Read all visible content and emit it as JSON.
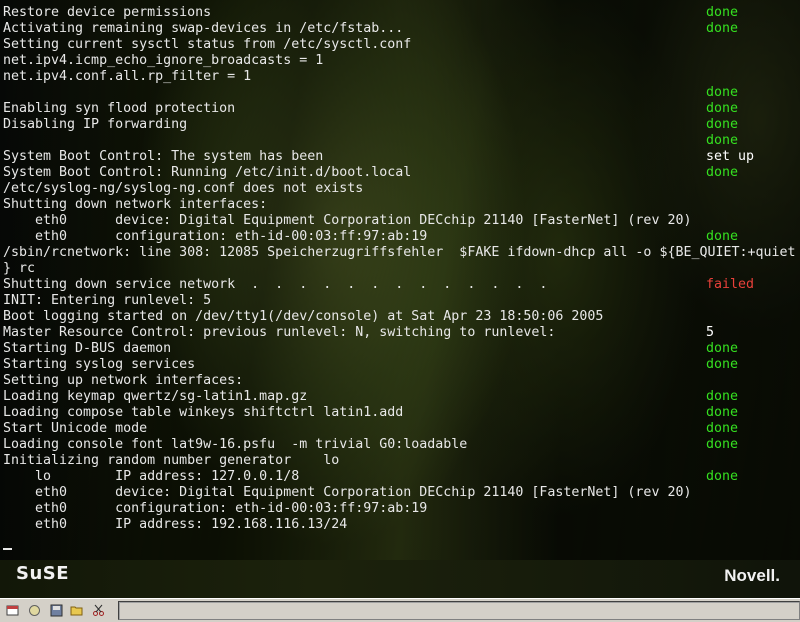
{
  "console": {
    "lines": [
      "Restore device permissions",
      "Activating remaining swap-devices in /etc/fstab...",
      "Setting current sysctl status from /etc/sysctl.conf",
      "net.ipv4.icmp_echo_ignore_broadcasts = 1",
      "net.ipv4.conf.all.rp_filter = 1",
      "",
      "Enabling syn flood protection",
      "Disabling IP forwarding",
      "",
      "System Boot Control: The system has been",
      "System Boot Control: Running /etc/init.d/boot.local",
      "/etc/syslog-ng/syslog-ng.conf does not exists",
      "Shutting down network interfaces:",
      "    eth0      device: Digital Equipment Corporation DECchip 21140 [FasterNet] (rev 20)",
      "    eth0      configuration: eth-id-00:03:ff:97:ab:19",
      "/sbin/rcnetwork: line 308: 12085 Speicherzugriffsfehler  $FAKE ifdown-dhcp all -o ${BE_QUIET:+quiet",
      "} rc",
      "Shutting down service network  .  .  .  .  .  .  .  .  .  .  .  .  .",
      "INIT: Entering runlevel: 5",
      "Boot logging started on /dev/tty1(/dev/console) at Sat Apr 23 18:50:06 2005",
      "Master Resource Control: previous runlevel: N, switching to runlevel:",
      "Starting D-BUS daemon",
      "Starting syslog services",
      "Setting up network interfaces:",
      "Loading keymap qwertz/sg-latin1.map.gz",
      "Loading compose table winkeys shiftctrl latin1.add",
      "Start Unicode mode",
      "Loading console font lat9w-16.psfu  -m trivial G0:loadable",
      "Initializing random number generator    lo",
      "    lo        IP address: 127.0.0.1/8",
      "    eth0      device: Digital Equipment Corporation DECchip 21140 [FasterNet] (rev 20)",
      "    eth0      configuration: eth-id-00:03:ff:97:ab:19",
      "    eth0      IP address: 192.168.116.13/24"
    ],
    "statuses": [
      {
        "row": 0,
        "text": "done",
        "type": "done"
      },
      {
        "row": 1,
        "text": "done",
        "type": "done"
      },
      {
        "row": 5,
        "text": "done",
        "type": "done"
      },
      {
        "row": 6,
        "text": "done",
        "type": "done"
      },
      {
        "row": 7,
        "text": "done",
        "type": "done"
      },
      {
        "row": 8,
        "text": "done",
        "type": "done"
      },
      {
        "row": 9,
        "text": "set up",
        "type": "white"
      },
      {
        "row": 10,
        "text": "done",
        "type": "done"
      },
      {
        "row": 14,
        "text": "done",
        "type": "done"
      },
      {
        "row": 17,
        "text": "failed",
        "type": "failed"
      },
      {
        "row": 20,
        "text": "5",
        "type": "white"
      },
      {
        "row": 21,
        "text": "done",
        "type": "done"
      },
      {
        "row": 22,
        "text": "done",
        "type": "done"
      },
      {
        "row": 24,
        "text": "done",
        "type": "done"
      },
      {
        "row": 25,
        "text": "done",
        "type": "done"
      },
      {
        "row": 26,
        "text": "done",
        "type": "done"
      },
      {
        "row": 27,
        "text": "done",
        "type": "done"
      },
      {
        "row": 29,
        "text": "done",
        "type": "done"
      }
    ],
    "cursor": "_"
  },
  "branding": {
    "left_logo": "SuSE",
    "right_logo": "Novell."
  },
  "taskbar": {
    "icons": [
      "window-icon",
      "circle-icon",
      "disk-icon",
      "folder-icon",
      "scissors-icon"
    ]
  },
  "colors": {
    "done": "#35e020",
    "failed": "#e8403a",
    "text": "#e8e8e8"
  }
}
